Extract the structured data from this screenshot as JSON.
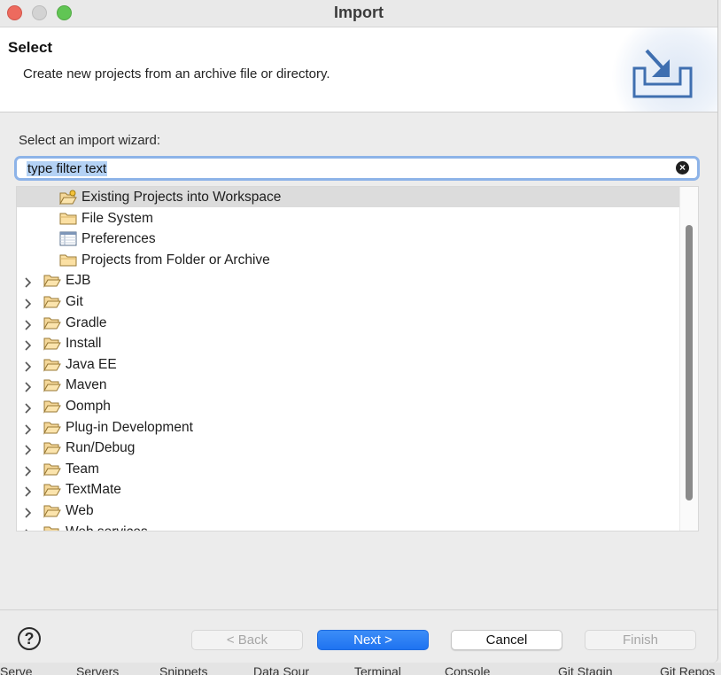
{
  "window": {
    "title": "Import"
  },
  "header": {
    "title": "Select",
    "description": "Create new projects from an archive file or directory."
  },
  "wizard": {
    "label": "Select an import wizard:",
    "filter_value": "type filter text",
    "clear_icon": "clear-x-icon"
  },
  "tree": {
    "children": [
      {
        "label": "Existing Projects into Workspace",
        "icon": "projects-folder-icon",
        "selected": true
      },
      {
        "label": "File System",
        "icon": "folder-icon"
      },
      {
        "label": "Preferences",
        "icon": "preferences-icon"
      },
      {
        "label": "Projects from Folder or Archive",
        "icon": "folder-icon"
      }
    ],
    "categories": [
      "EJB",
      "Git",
      "Gradle",
      "Install",
      "Java EE",
      "Maven",
      "Oomph",
      "Plug-in Development",
      "Run/Debug",
      "Team",
      "TextMate",
      "Web",
      "Web services"
    ]
  },
  "buttons": {
    "help": "?",
    "back": "< Back",
    "next": "Next >",
    "cancel": "Cancel",
    "finish": "Finish"
  },
  "background_tabs": [
    "Serve",
    "Servers",
    "Snippets",
    "Data Sour",
    "Terminal",
    "Console",
    "Git Stagin",
    "Git Repos"
  ],
  "colors": {
    "accent": "#1f73f1",
    "selection": "#dcdcdc",
    "filter_focus": "#8db3e8",
    "close": "#ed6a5e",
    "maximize": "#61c554"
  }
}
